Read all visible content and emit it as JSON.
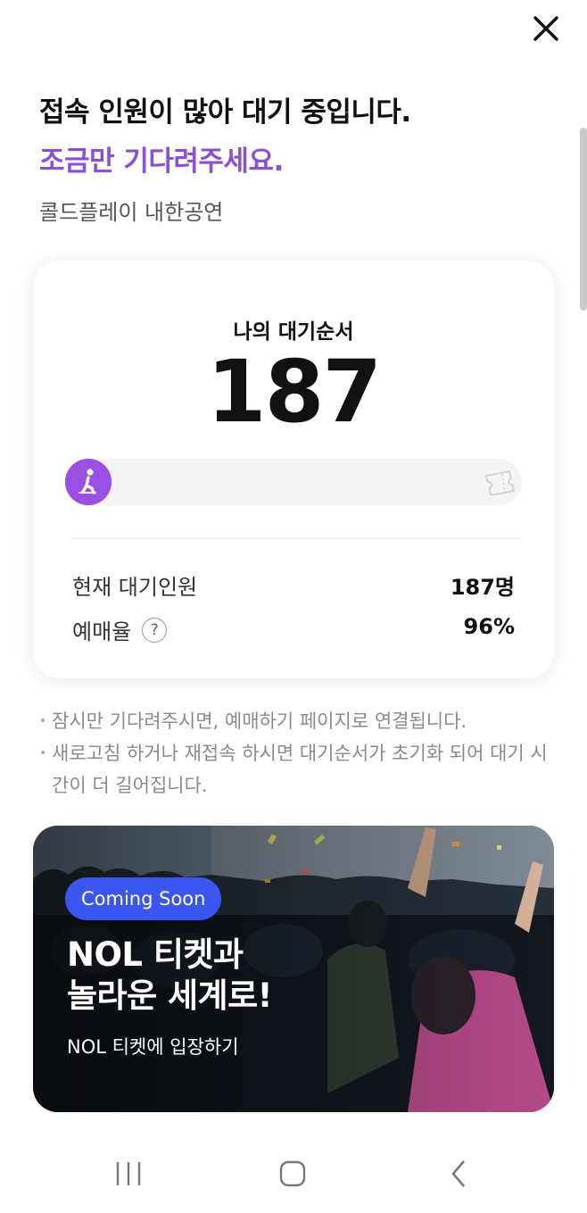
{
  "header": {
    "title": "접속 인원이 많아 대기 중입니다.",
    "subtitle": "조금만 기다려주세요.",
    "event_name": "콜드플레이 내한공연"
  },
  "queue_card": {
    "label": "나의 대기순서",
    "position": "187",
    "progress": 0.0,
    "rows": [
      {
        "label": "현재 대기인원",
        "value": "187명"
      },
      {
        "label": "예매율",
        "help": "?",
        "value": "96%"
      }
    ]
  },
  "notes": [
    "잠시만 기다려주시면, 예매하기 페이지로 연결됩니다.",
    "새로고침 하거나 재접속 하시면 대기순서가 초기화 되어 대기 시간이 더 길어집니다."
  ],
  "banner": {
    "badge": "Coming Soon",
    "title_line1": "NOL 티켓과",
    "title_line2": "놀라운 세계로!",
    "subtitle": "NOL 티켓에 입장하기"
  },
  "icons": {
    "close": "close-icon",
    "runner": "runner-icon",
    "ticket": "ticket-icon",
    "recent_apps": "recent-apps-icon",
    "home": "home-icon",
    "back": "back-icon"
  },
  "colors": {
    "accent": "#8a4fd6",
    "runner_bg": "#9b4fe3",
    "badge": "#3a55f0"
  }
}
